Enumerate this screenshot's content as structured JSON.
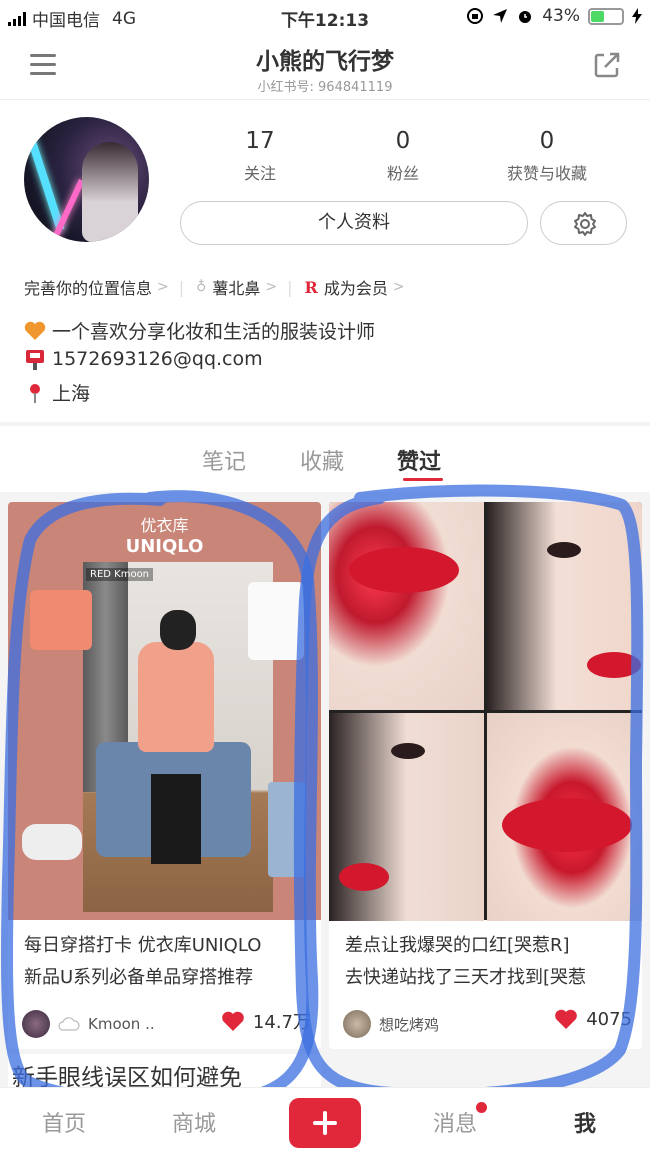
{
  "status_bar": {
    "carrier": "中国电信",
    "network": "4G",
    "time": "下午12:13",
    "battery": "43%",
    "battery_level": 0.43
  },
  "header": {
    "title": "小熊的飞行梦",
    "subtitle": "小红书号: 964841119",
    "icons": [
      "menu-icon",
      "share-icon"
    ]
  },
  "profile": {
    "stats": [
      {
        "value": "17",
        "label": "关注"
      },
      {
        "value": "0",
        "label": "粉丝"
      },
      {
        "value": "0",
        "label": "获赞与收藏"
      }
    ],
    "edit_button": "个人资料",
    "links": [
      {
        "label": "完善你的位置信息"
      },
      {
        "label": "薯北鼻"
      },
      {
        "label": "成为会员",
        "logo": "R"
      }
    ],
    "bio": [
      {
        "icon": "heart-icon",
        "text": "一个喜欢分享化妆和生活的服装设计师"
      },
      {
        "icon": "mailbox-icon",
        "text": "1572693126@qq.com"
      },
      {
        "icon": "location-pin-icon",
        "text": "上海"
      }
    ]
  },
  "tabs": [
    {
      "label": "笔记",
      "active": false
    },
    {
      "label": "收藏",
      "active": false
    },
    {
      "label": "赞过",
      "active": true
    }
  ],
  "cards": [
    {
      "image_text_cn": "优衣库",
      "image_text_en": "UNIQLO",
      "image_tag": "RED Kmoon",
      "title_line1": "每日穿搭打卡 优衣库UNIQLO",
      "title_line2": "新品U系列必备单品穿搭推荐",
      "author": "Kmoon ..",
      "likes": "14.7万"
    },
    {
      "title_line1": "差点让我爆哭的口红[哭惹R]",
      "title_line2": "去快递站找了三天才找到[哭惹",
      "author": "想吃烤鸡",
      "likes": "4075"
    }
  ],
  "next_card_title": "新手眼线误区如何避免",
  "bottom_nav": [
    {
      "label": "首页",
      "active": false
    },
    {
      "label": "商城",
      "active": false
    },
    {
      "label": "消息",
      "active": false,
      "badge": true
    },
    {
      "label": "我",
      "active": true
    }
  ],
  "colors": {
    "accent": "#e0283a",
    "annotation": "#3b6fe0"
  }
}
